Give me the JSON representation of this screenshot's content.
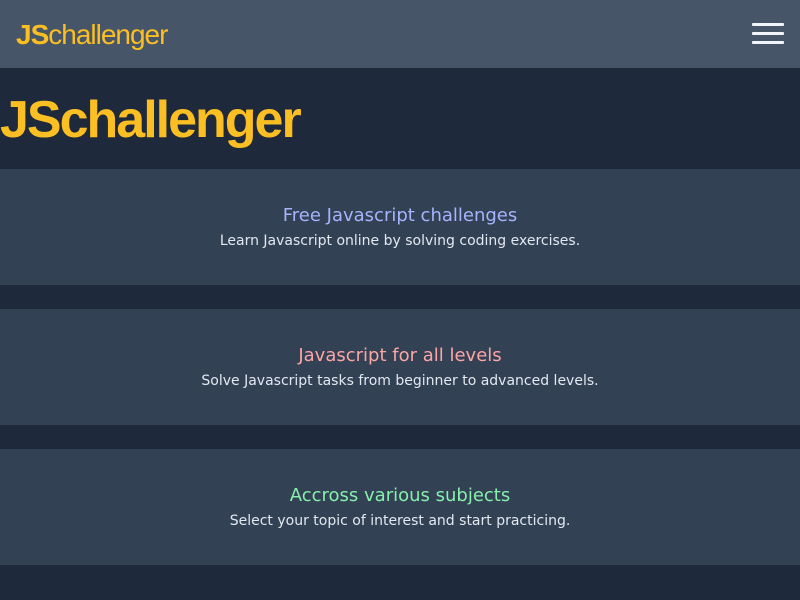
{
  "header": {
    "brand_js": "JS",
    "brand_rest": "challenger",
    "menu_icon": "hamburger-menu-icon"
  },
  "hero": {
    "logo_js": "JS",
    "logo_rest": "challenger"
  },
  "features": [
    {
      "title": "Free Javascript challenges",
      "text": "Learn Javascript online by solving coding exercises.",
      "title_color": "#a5b4fc"
    },
    {
      "title": "Javascript for all levels",
      "text": "Solve Javascript tasks from beginner to advanced levels.",
      "title_color": "#fca5a5"
    },
    {
      "title": "Accross various subjects",
      "text": "Select your topic of interest and start practicing.",
      "title_color": "#86efac"
    }
  ],
  "colors": {
    "brand": "#fbbf24",
    "header_bg": "#475569",
    "page_bg": "#1e293b",
    "card_bg": "#334155"
  }
}
